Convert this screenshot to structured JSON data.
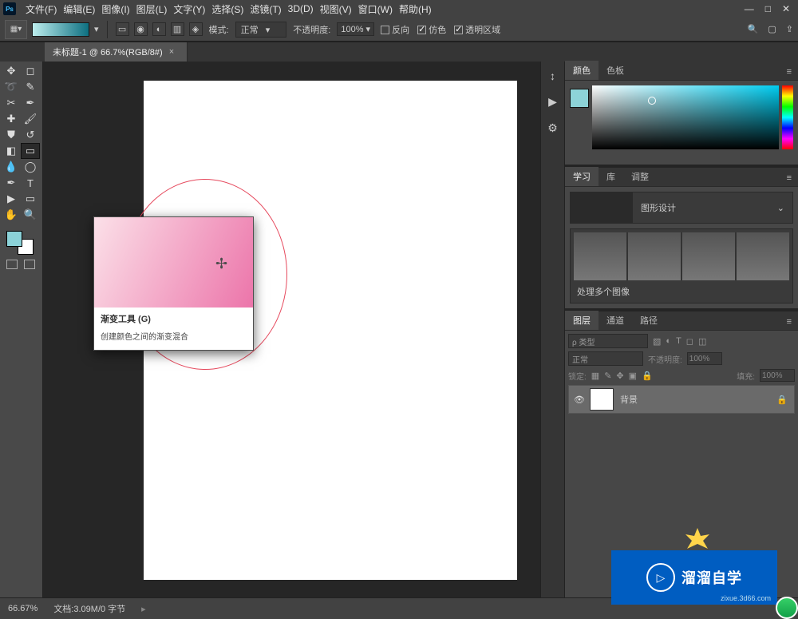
{
  "menubar": {
    "items": [
      "文件(F)",
      "编辑(E)",
      "图像(I)",
      "图层(L)",
      "文字(Y)",
      "选择(S)",
      "滤镜(T)",
      "3D(D)",
      "视图(V)",
      "窗口(W)",
      "帮助(H)"
    ]
  },
  "optionsbar": {
    "mode_label": "模式:",
    "mode_value": "正常",
    "opacity_label": "不透明度:",
    "opacity_value": "100%",
    "reverse": "反向",
    "dither": "仿色",
    "transparent": "透明区域"
  },
  "document": {
    "tab_label": "未标题-1 @ 66.7%(RGB/8#)"
  },
  "tooltip": {
    "title": "渐变工具 (G)",
    "desc": "创建颜色之间的渐变混合"
  },
  "panels": {
    "color_tabs": [
      "颜色",
      "色板"
    ],
    "learn_tabs": [
      "学习",
      "库",
      "调整"
    ],
    "learn_select": "图形设计",
    "learn_card": "处理多个图像",
    "layer_tabs": [
      "图层",
      "通道",
      "路径"
    ],
    "layer_search": "ρ 类型",
    "layer_normal": "正常",
    "layer_opacity_label": "不透明度:",
    "layer_opacity_value": "100%",
    "layer_lock_label": "锁定:",
    "layer_fill_label": "填充:",
    "layer_fill_value": "100%",
    "bg_layer": "背景"
  },
  "statusbar": {
    "zoom": "66.67%",
    "doc": "文档:3.09M/0 字节"
  },
  "watermark": {
    "text": "溜溜自学",
    "sub": "zixue.3d66.com"
  }
}
